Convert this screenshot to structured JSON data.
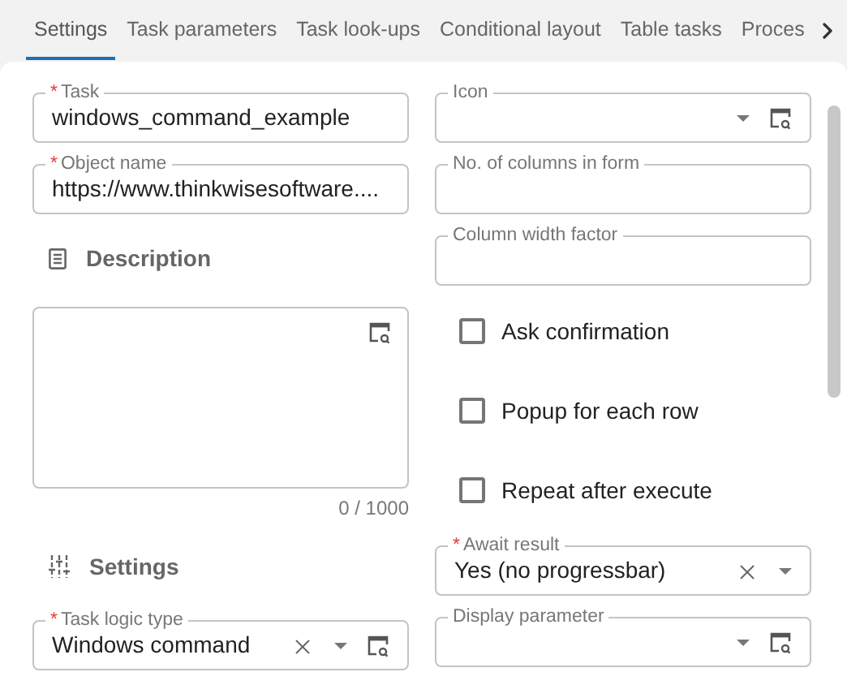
{
  "tabs": [
    {
      "label": "Settings",
      "selected": true
    },
    {
      "label": "Task parameters",
      "selected": false
    },
    {
      "label": "Task look-ups",
      "selected": false
    },
    {
      "label": "Conditional layout",
      "selected": false
    },
    {
      "label": "Table tasks",
      "selected": false
    },
    {
      "label": "Proces",
      "selected": false
    }
  ],
  "left_column": [
    {
      "kind": "field",
      "required_mark": "*",
      "label": "Task",
      "value": "windows_command_example"
    },
    {
      "kind": "field",
      "required_mark": "*",
      "label": "Object name",
      "value": "https://www.thinkwisesoftware...."
    },
    {
      "kind": "heading",
      "label": "Description"
    },
    {
      "kind": "textarea",
      "counter": "0 / 1000",
      "lookup": true
    },
    {
      "kind": "heading",
      "label": "Settings"
    },
    {
      "kind": "field",
      "required_mark": "*",
      "label": "Task logic type",
      "value": "Windows command",
      "clearable": true,
      "dropdown": true,
      "lookup": true
    }
  ],
  "right_column": [
    {
      "kind": "field",
      "label": "Icon",
      "dropdown": true,
      "lookup": true
    },
    {
      "kind": "field",
      "label": "No. of columns in form"
    },
    {
      "kind": "field",
      "label": "Column width factor"
    },
    {
      "kind": "checkbox",
      "label": "Ask confirmation",
      "checked": false
    },
    {
      "kind": "checkbox",
      "label": "Popup for each row",
      "checked": false
    },
    {
      "kind": "checkbox",
      "label": "Repeat after execute",
      "checked": false
    },
    {
      "kind": "field",
      "required_mark": "*",
      "label": "Await result",
      "value": "Yes (no progressbar)",
      "clearable": true,
      "dropdown": true
    },
    {
      "kind": "field",
      "label": "Display parameter",
      "dropdown": true,
      "lookup": true
    }
  ]
}
